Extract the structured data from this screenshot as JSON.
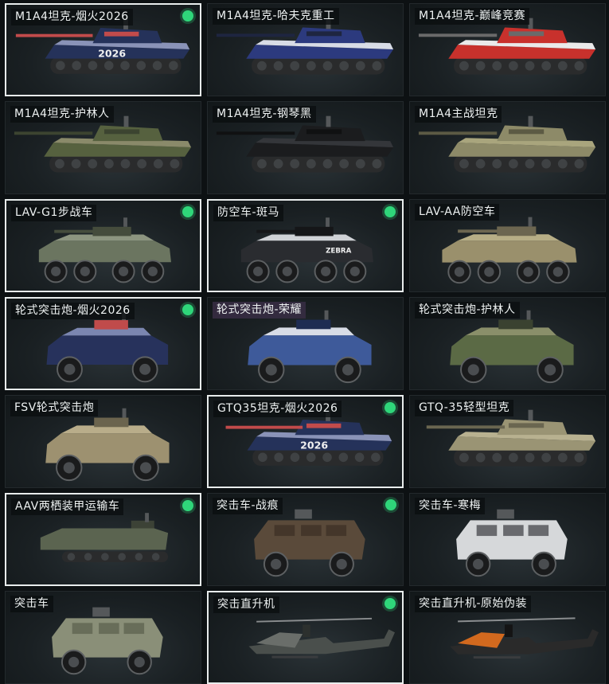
{
  "vehicles": [
    {
      "name": "M1A4坦克-烟火2026",
      "selected": true,
      "badge": true,
      "kind": "tank",
      "colors": [
        "#25325a",
        "#8a93b8",
        "#c24b4b"
      ],
      "decal": "2026"
    },
    {
      "name": "M1A4坦克-哈夫克重工",
      "selected": false,
      "badge": false,
      "kind": "tank",
      "colors": [
        "#2c3a7e",
        "#d8dce6",
        "#1e2540"
      ],
      "decal": ""
    },
    {
      "name": "M1A4坦克-巅峰竞赛",
      "selected": false,
      "badge": false,
      "kind": "tank",
      "colors": [
        "#c8312c",
        "#eaeaea",
        "#6a6a6a"
      ],
      "decal": ""
    },
    {
      "name": "M1A4坦克-护林人",
      "selected": false,
      "badge": false,
      "kind": "tank",
      "colors": [
        "#56613f",
        "#8a8a6a",
        "#3c4430"
      ],
      "decal": ""
    },
    {
      "name": "M1A4坦克-钢琴黑",
      "selected": false,
      "badge": false,
      "kind": "tank",
      "colors": [
        "#1b1c1e",
        "#34363a",
        "#101112"
      ],
      "decal": ""
    },
    {
      "name": "M1A4主战坦克",
      "selected": false,
      "badge": false,
      "kind": "tank",
      "colors": [
        "#8d8a68",
        "#a9a57d",
        "#5c5a44"
      ],
      "decal": ""
    },
    {
      "name": "LAV-G1步战车",
      "selected": true,
      "badge": true,
      "kind": "ifv",
      "colors": [
        "#6b7560",
        "#8d9580",
        "#454c3c"
      ],
      "decal": ""
    },
    {
      "name": "防空车-斑马",
      "selected": true,
      "badge": true,
      "kind": "ifv",
      "colors": [
        "#2a2c30",
        "#cfd2d6",
        "#151618"
      ],
      "decal": "ZEBRA"
    },
    {
      "name": "LAV-AA防空车",
      "selected": false,
      "badge": false,
      "kind": "ifv",
      "colors": [
        "#9a906c",
        "#b7ae86",
        "#6c6650"
      ],
      "decal": ""
    },
    {
      "name": "轮式突击炮-烟火2026",
      "selected": true,
      "badge": true,
      "kind": "armored",
      "colors": [
        "#27325c",
        "#7b86b0",
        "#c04b4b"
      ],
      "decal": ""
    },
    {
      "name": "轮式突击炮-荣耀",
      "selected": false,
      "badge": false,
      "kind": "armored",
      "colors": [
        "#3e5a9a",
        "#d8dce6",
        "#1e2c52"
      ],
      "decal": "",
      "purple": true
    },
    {
      "name": "轮式突击炮-护林人",
      "selected": false,
      "badge": false,
      "kind": "armored",
      "colors": [
        "#5b6a45",
        "#8a8f6a",
        "#3a4230"
      ],
      "decal": ""
    },
    {
      "name": "FSV轮式突击炮",
      "selected": false,
      "badge": false,
      "kind": "armored",
      "colors": [
        "#9d9170",
        "#b9ad8a",
        "#6b644e"
      ],
      "decal": ""
    },
    {
      "name": "GTQ35坦克-烟火2026",
      "selected": true,
      "badge": true,
      "kind": "light",
      "colors": [
        "#25325a",
        "#8a93b8",
        "#c24b4b"
      ],
      "decal": "2026"
    },
    {
      "name": "GTQ-35轻型坦克",
      "selected": false,
      "badge": false,
      "kind": "light",
      "colors": [
        "#9a9474",
        "#b8b190",
        "#6a6650"
      ],
      "decal": ""
    },
    {
      "name": "AAV两栖装甲运输车",
      "selected": true,
      "badge": true,
      "kind": "aav",
      "colors": [
        "#5b6450",
        "#7c846c",
        "#3c4236"
      ],
      "decal": ""
    },
    {
      "name": "突击车-战痕",
      "selected": false,
      "badge": true,
      "kind": "mrap",
      "colors": [
        "#5a4a3a",
        "#8a7a64",
        "#3a2e24"
      ],
      "decal": ""
    },
    {
      "name": "突击车-寒梅",
      "selected": false,
      "badge": false,
      "kind": "mrap",
      "colors": [
        "#d6d8da",
        "#f0f0f0",
        "#3a3c40"
      ],
      "decal": ""
    },
    {
      "name": "突击车",
      "selected": false,
      "badge": false,
      "kind": "mrap",
      "colors": [
        "#8a8f78",
        "#a8ad95",
        "#5a5e4c"
      ],
      "decal": ""
    },
    {
      "name": "突击直升机",
      "selected": true,
      "badge": true,
      "kind": "heli",
      "colors": [
        "#4a4f4c",
        "#6a6e6a",
        "#2c302e"
      ],
      "decal": ""
    },
    {
      "name": "突击直升机-原始伪装",
      "selected": false,
      "badge": false,
      "kind": "heli",
      "colors": [
        "#2a2a2a",
        "#d2691e",
        "#141414"
      ],
      "decal": ""
    }
  ]
}
